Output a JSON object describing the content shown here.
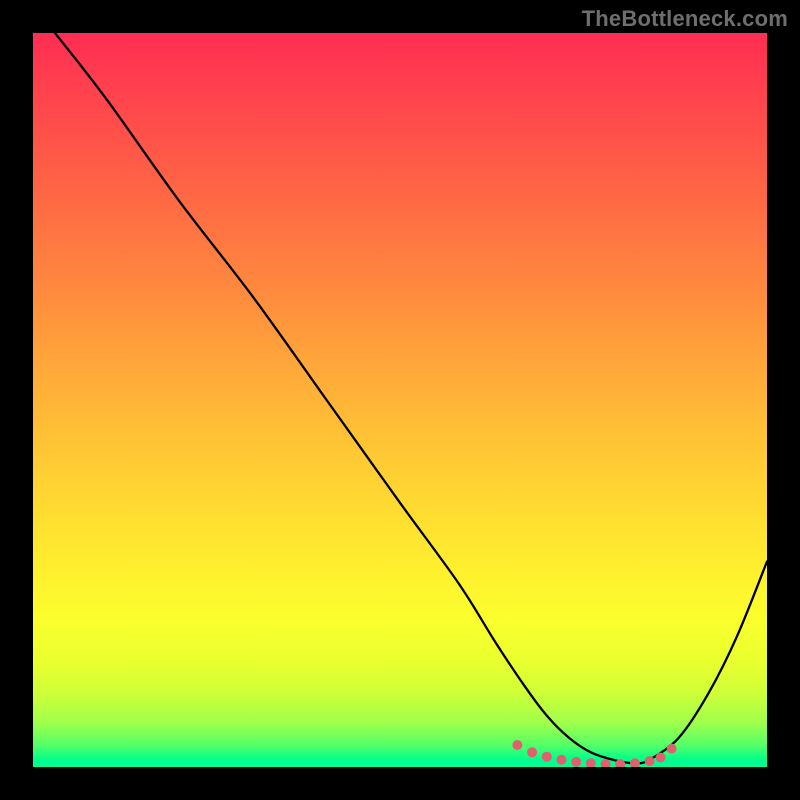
{
  "watermark": "TheBottleneck.com",
  "chart_data": {
    "type": "line",
    "title": "",
    "xlabel": "",
    "ylabel": "",
    "xlim": [
      0,
      100
    ],
    "ylim": [
      0,
      100
    ],
    "grid": false,
    "legend": false,
    "series": [
      {
        "name": "main-curve",
        "color": "#000000",
        "x": [
          3,
          10,
          20,
          30,
          40,
          50,
          58,
          63,
          67,
          70,
          73,
          76,
          79,
          82,
          84,
          88,
          92,
          96,
          100
        ],
        "y": [
          100,
          91,
          77,
          64,
          50,
          36,
          25,
          17,
          11,
          7,
          4,
          2,
          1,
          0.5,
          1,
          4,
          10,
          18,
          28
        ]
      },
      {
        "name": "minimum-dots",
        "color": "#e06070",
        "style": "dots",
        "x": [
          66,
          68,
          70,
          72,
          74,
          76,
          78,
          80,
          82,
          84,
          85.5,
          87
        ],
        "y": [
          3.0,
          2.0,
          1.4,
          1.0,
          0.7,
          0.5,
          0.4,
          0.4,
          0.5,
          0.8,
          1.3,
          2.5
        ]
      }
    ]
  }
}
